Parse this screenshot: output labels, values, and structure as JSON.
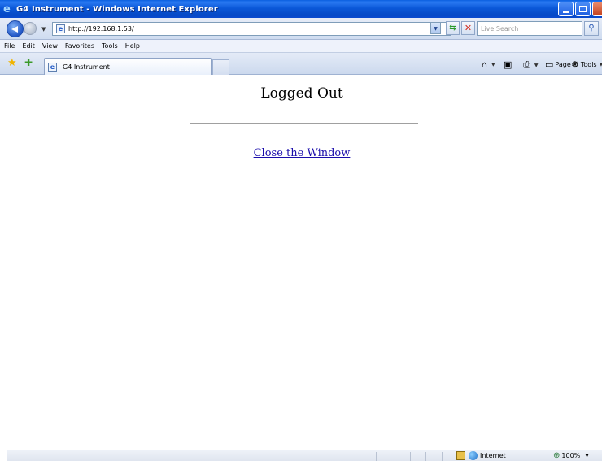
{
  "window": {
    "title": "G4 Instrument - Windows Internet Explorer"
  },
  "address_bar": {
    "url": "http://192.168.1.53/"
  },
  "search": {
    "placeholder": "Live Search"
  },
  "menu": {
    "items": [
      "File",
      "Edit",
      "View",
      "Favorites",
      "Tools",
      "Help"
    ]
  },
  "tab": {
    "label": "G4 Instrument"
  },
  "command_bar": {
    "page_label": "Page",
    "tools_label": "Tools"
  },
  "content": {
    "heading": "Logged Out",
    "link_label": "Close the Window"
  },
  "status_bar": {
    "zone": "Internet",
    "zoom": "100%"
  },
  "colors": {
    "title_bar": "#0a5fe0",
    "link": "#1a0dab"
  }
}
